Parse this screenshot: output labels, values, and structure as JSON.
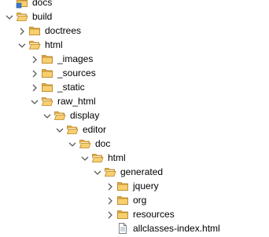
{
  "colors": {
    "folder_back": "#E0A93E",
    "folder_front": "#F7CF6E",
    "folder_inner": "#FDF3D6",
    "chevron": "#5B5B5B",
    "file_border": "#7A7A7A",
    "file_lines": "#8FA6BE",
    "project_accent": "#3C78C8"
  },
  "tree": [
    {
      "label": "docs",
      "depth": 0,
      "toggle": "none",
      "icon": "project-folder-icon"
    },
    {
      "label": "build",
      "depth": 0,
      "toggle": "expanded",
      "icon": "folder-open-icon"
    },
    {
      "label": "doctrees",
      "depth": 1,
      "toggle": "collapsed",
      "icon": "folder-icon"
    },
    {
      "label": "html",
      "depth": 1,
      "toggle": "expanded",
      "icon": "folder-open-icon"
    },
    {
      "label": "_images",
      "depth": 2,
      "toggle": "collapsed",
      "icon": "folder-icon"
    },
    {
      "label": "_sources",
      "depth": 2,
      "toggle": "collapsed",
      "icon": "folder-icon"
    },
    {
      "label": "_static",
      "depth": 2,
      "toggle": "collapsed",
      "icon": "folder-icon"
    },
    {
      "label": "raw_html",
      "depth": 2,
      "toggle": "expanded",
      "icon": "folder-open-icon"
    },
    {
      "label": "display",
      "depth": 3,
      "toggle": "expanded",
      "icon": "folder-open-icon"
    },
    {
      "label": "editor",
      "depth": 4,
      "toggle": "expanded",
      "icon": "folder-open-icon"
    },
    {
      "label": "doc",
      "depth": 5,
      "toggle": "expanded",
      "icon": "folder-open-icon"
    },
    {
      "label": "html",
      "depth": 6,
      "toggle": "expanded",
      "icon": "folder-open-icon"
    },
    {
      "label": "generated",
      "depth": 7,
      "toggle": "expanded",
      "icon": "folder-open-icon"
    },
    {
      "label": "jquery",
      "depth": 8,
      "toggle": "collapsed",
      "icon": "folder-icon"
    },
    {
      "label": "org",
      "depth": 8,
      "toggle": "collapsed",
      "icon": "folder-icon"
    },
    {
      "label": "resources",
      "depth": 8,
      "toggle": "collapsed",
      "icon": "folder-icon"
    },
    {
      "label": "allclasses-index.html",
      "depth": 8,
      "toggle": "none",
      "icon": "html-file-icon"
    }
  ]
}
